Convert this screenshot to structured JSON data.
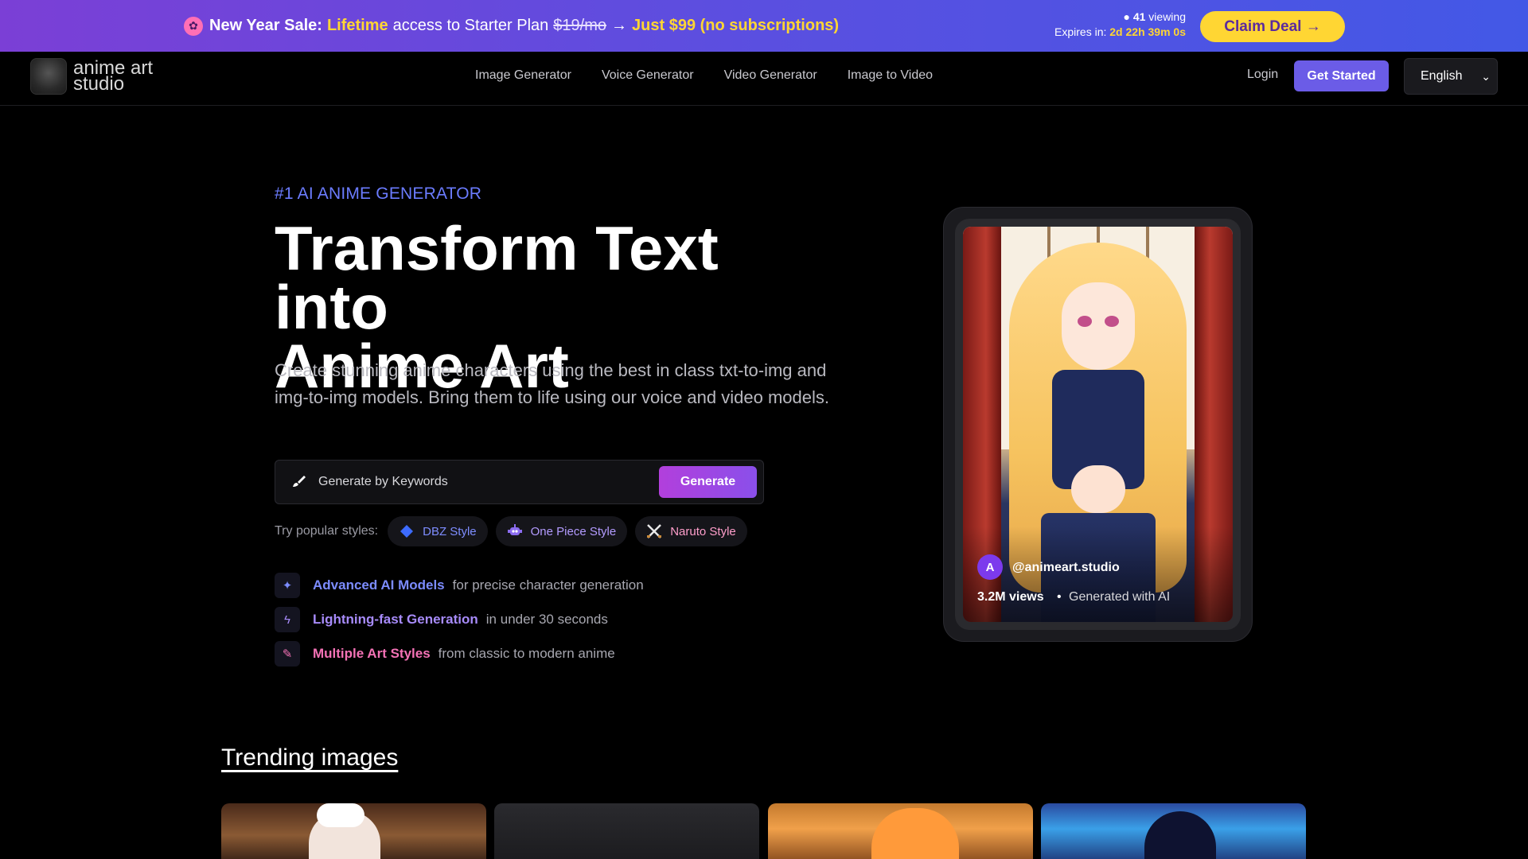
{
  "promo": {
    "label": "New Year Sale:",
    "lifetime": "Lifetime",
    "mid": "access to Starter Plan",
    "old_price": "$19/mo",
    "arrow": "→",
    "new_price": "Just $99 (no subscriptions)",
    "viewing_count": "41",
    "viewing_text": "viewing",
    "expires_label": "Expires in:",
    "expires_time": "2d 22h 39m 0s",
    "cta": "Claim Deal →"
  },
  "nav": {
    "logo_line1": "anime art",
    "logo_line2": "studio",
    "links": [
      "Image Generator",
      "Voice Generator",
      "Video Generator",
      "Image to Video"
    ],
    "login": "Login",
    "get_started": "Get Started",
    "language": "English"
  },
  "hero": {
    "eyebrow": "#1 AI ANIME GENERATOR",
    "title_line1": "Transform Text into",
    "title_line2": "Anime Art",
    "description": "Create stunning anime characters using the best in class txt-to-img and img-to-img models. Bring them to life using our voice and video models.",
    "input_placeholder": "Generate by Keywords",
    "generate_button": "Generate",
    "styles_label": "Try popular styles:",
    "styles": [
      {
        "label": "DBZ Style",
        "icon": "diamond-icon"
      },
      {
        "label": "One Piece Style",
        "icon": "robot-icon"
      },
      {
        "label": "Naruto Style",
        "icon": "crossed-swords-icon"
      }
    ],
    "features": [
      {
        "title": "Advanced AI Models",
        "rest": "for precise character generation",
        "icon": "sparkles-icon",
        "color": "#7c8cff"
      },
      {
        "title": "Lightning-fast Generation",
        "rest": "in under 30 seconds",
        "icon": "lightning-icon",
        "color": "#a78bfa"
      },
      {
        "title": "Multiple Art Styles",
        "rest": "from classic to modern anime",
        "icon": "brush-icon",
        "color": "#f472b6"
      }
    ]
  },
  "showcase": {
    "avatar_letter": "A",
    "handle": "@animeart.studio",
    "views": "3.2M views",
    "separator": "•",
    "generated": "Generated with AI"
  },
  "trending": {
    "title": "Trending images"
  },
  "colors": {
    "accent": "#6b5ce7",
    "yellow": "#ffd633",
    "eyebrow": "#6b7cff"
  }
}
